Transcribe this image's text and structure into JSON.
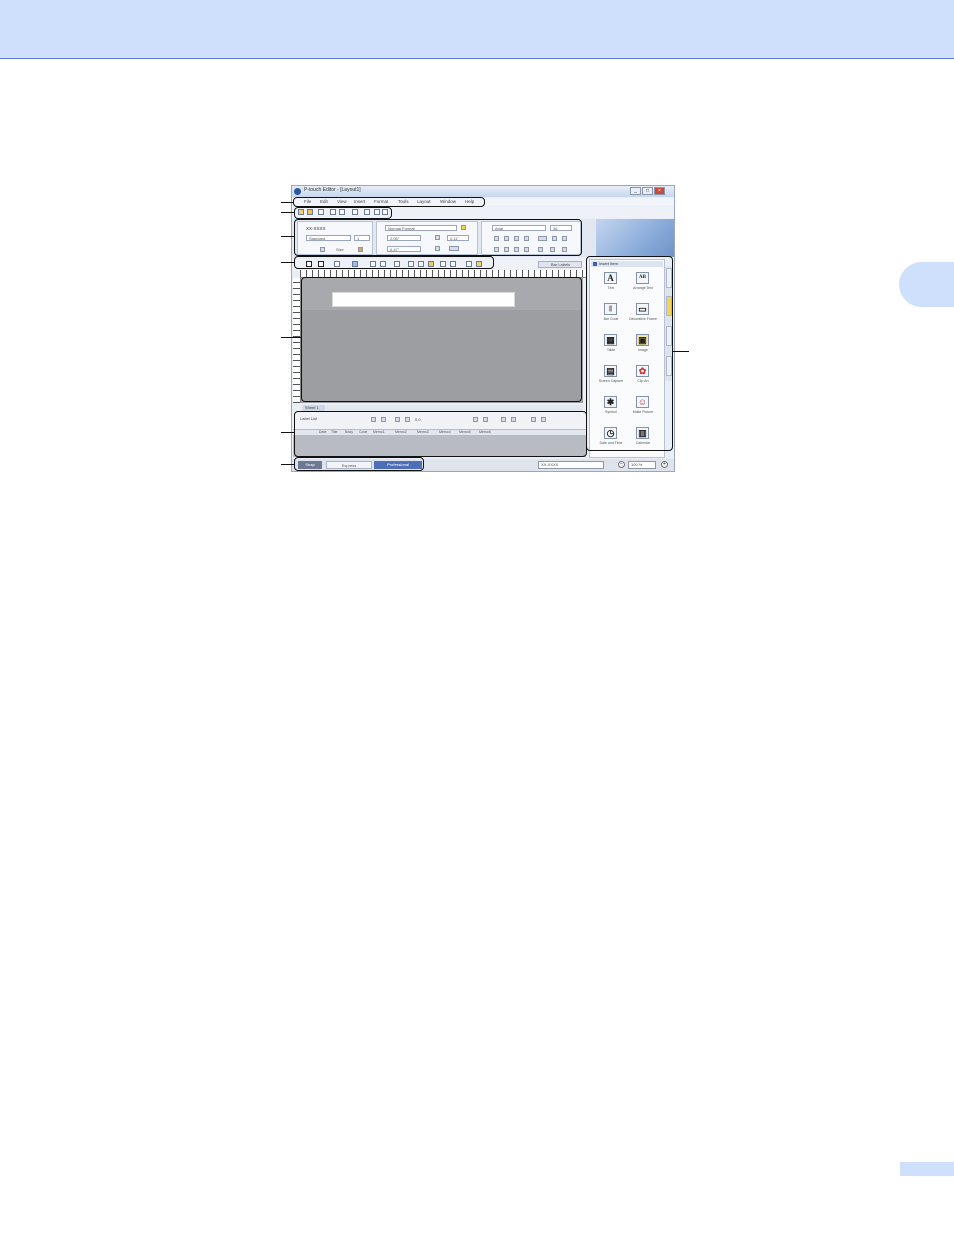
{
  "window": {
    "title": "P-touch Editor - [Layout1]",
    "controls": [
      "_",
      "□",
      "×"
    ]
  },
  "menu": [
    "File",
    "Edit",
    "View",
    "Insert",
    "Format",
    "Tools",
    "Layout",
    "Window",
    "Help"
  ],
  "property_dock": {
    "printer_name": "XX-XXXX",
    "paper_option": "Standard",
    "copies_value": "1",
    "size_label": "Size",
    "format_label": "Normal Format",
    "length_value": "2.05\"",
    "offset_value": "0.11\"",
    "width_value": "0.47\"",
    "font_name": "Arial",
    "font_size": "36"
  },
  "toolbar2": {
    "bar_label": "Bar Labels"
  },
  "layout": {
    "sheet_tab": "Sheet 1"
  },
  "database": {
    "link_label": "Label List",
    "record_count": "0,0",
    "columns": [
      "Date",
      "Title",
      "Body",
      "Code",
      "Memo1",
      "Memo2",
      "Memo3",
      "Memo4",
      "Memo5",
      "Memo6"
    ]
  },
  "status": {
    "modes": [
      "Snap",
      "Express",
      "Professional"
    ],
    "printer_select": "XX-XXXX",
    "zoom": "100 %"
  },
  "sidebar": {
    "title": "Insert Item",
    "items": [
      {
        "label": "Text",
        "glyph": "A"
      },
      {
        "label": "Arrange Text",
        "glyph": "AB"
      },
      {
        "label": "Bar Code",
        "glyph": "|||"
      },
      {
        "label": "Decorative Frame",
        "glyph": "▭"
      },
      {
        "label": "Table",
        "glyph": "▦"
      },
      {
        "label": "Image",
        "glyph": "▣"
      },
      {
        "label": "Screen Capture",
        "glyph": "▤"
      },
      {
        "label": "Clip Art",
        "glyph": "✿"
      },
      {
        "label": "Symbol",
        "glyph": "✱"
      },
      {
        "label": "Make Picture",
        "glyph": "☺"
      },
      {
        "label": "Date and Time",
        "glyph": "◷"
      },
      {
        "label": "Calendar",
        "glyph": "▥"
      }
    ]
  },
  "colors": {
    "header_band": "#cfe0fc",
    "header_rule": "#5f7ec8",
    "canvas": "#9c9ea2",
    "callout": "#111111"
  }
}
